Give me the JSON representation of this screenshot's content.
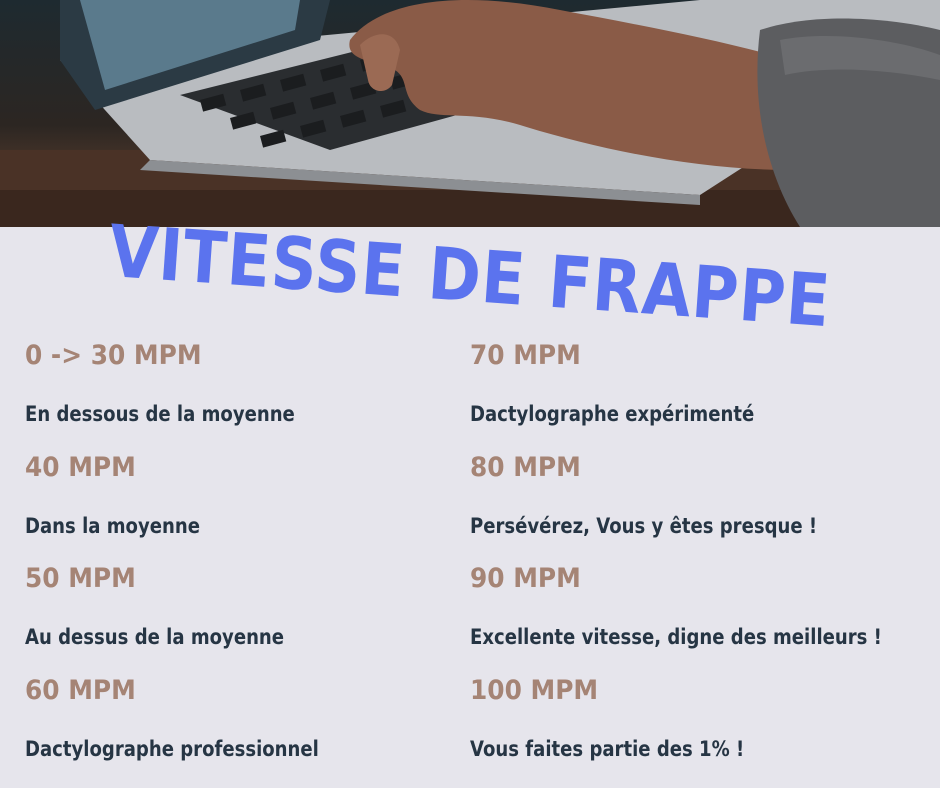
{
  "photo": {
    "description_icon": "laptop-typing-photo"
  },
  "title": "VITESSE DE FRAPPE",
  "left": [
    {
      "speed": "0 -> 30 MPM",
      "label": "En dessous de la moyenne"
    },
    {
      "speed": "40 MPM",
      "label": "Dans la moyenne"
    },
    {
      "speed": "50 MPM",
      "label": "Au dessus de la moyenne"
    },
    {
      "speed": "60 MPM",
      "label": "Dactylographe professionnel"
    }
  ],
  "right": [
    {
      "speed": "70 MPM",
      "label": "Dactylographe expérimenté"
    },
    {
      "speed": "80 MPM",
      "label": "Persévérez, Vous y êtes presque !"
    },
    {
      "speed": "90 MPM",
      "label": "Excellente vitesse, digne des meilleurs !"
    },
    {
      "speed": "100 MPM",
      "label": "Vous faites partie des 1% !"
    }
  ],
  "colors": {
    "title": "#5b73ee",
    "speed": "#a58475",
    "label": "#263544",
    "background": "#e6e5ec"
  }
}
